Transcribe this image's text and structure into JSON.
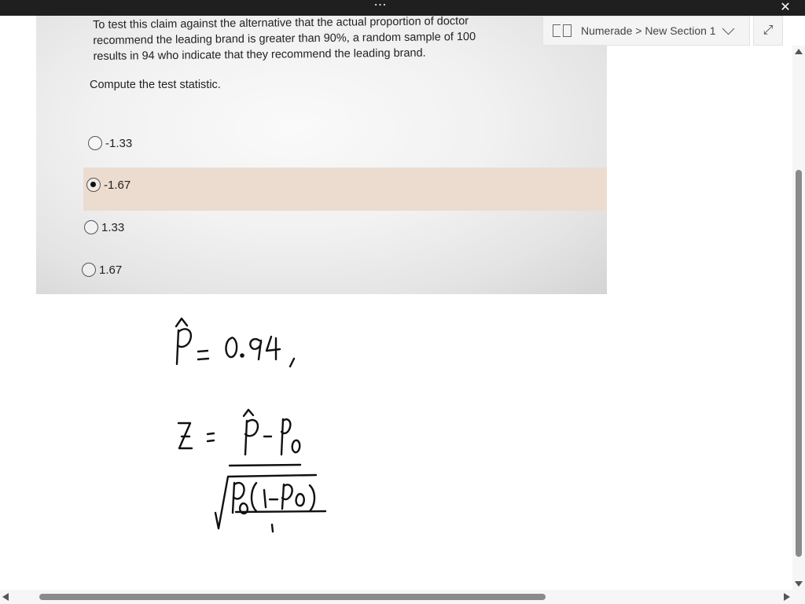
{
  "window": {
    "more_icon": "ellipsis-icon",
    "close_icon": "close-icon"
  },
  "question": {
    "lines": [
      "To test this claim against the alternative that the actual proportion of doctor",
      "recommend the leading brand is greater than 90%, a random sample of 100",
      "results in 94 who indicate that they recommend the leading brand."
    ],
    "prompt": "Compute the test statistic.",
    "options": [
      {
        "label": "-1.33",
        "selected": false
      },
      {
        "label": "-1.67",
        "selected": true
      },
      {
        "label": "1.33",
        "selected": false
      },
      {
        "label": "1.67",
        "selected": false
      }
    ],
    "highlight_color": "#ecdccf"
  },
  "handwriting": {
    "line1": "p̂ = 0.94,",
    "line2": "Z = (p̂ − p₀) / √(p₀(1 − p₀)/n)"
  },
  "notebook": {
    "location": "Numerade > New Section 1",
    "icon": "notebook-icon",
    "dropdown_icon": "chevron-down-icon",
    "expand_icon": "expand-icon"
  }
}
